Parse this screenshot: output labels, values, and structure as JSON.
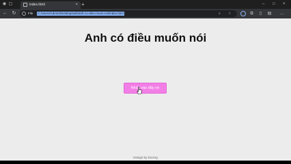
{
  "browser": {
    "tab": {
      "title": "index.html",
      "close_glyph": "×",
      "favicon": "document-icon"
    },
    "new_tab_glyph": "+",
    "window_controls": {
      "minimize": "–",
      "maximize": "□",
      "close": "×"
    },
    "address_bar": {
      "prefix": "File",
      "url": "C:/Users/Admin/Desktop/web/anh-co-dieu-muon-noi/index.html"
    },
    "icons": {
      "back": "←",
      "forward": "→",
      "reload": "↻",
      "zoom": "⌕",
      "favorite": "☆",
      "extensions": "⧉",
      "split": "▯",
      "collections": "▤",
      "more": "…"
    }
  },
  "page": {
    "heading": "Anh có điều muốn nói",
    "button_label": "Nhấn vào đây nè",
    "footer": "Design by Dương"
  },
  "colors": {
    "button": "#f27fe6",
    "page_background": "#ececec",
    "chrome_dark": "#202124",
    "url_highlight": "#8ab4f8"
  }
}
